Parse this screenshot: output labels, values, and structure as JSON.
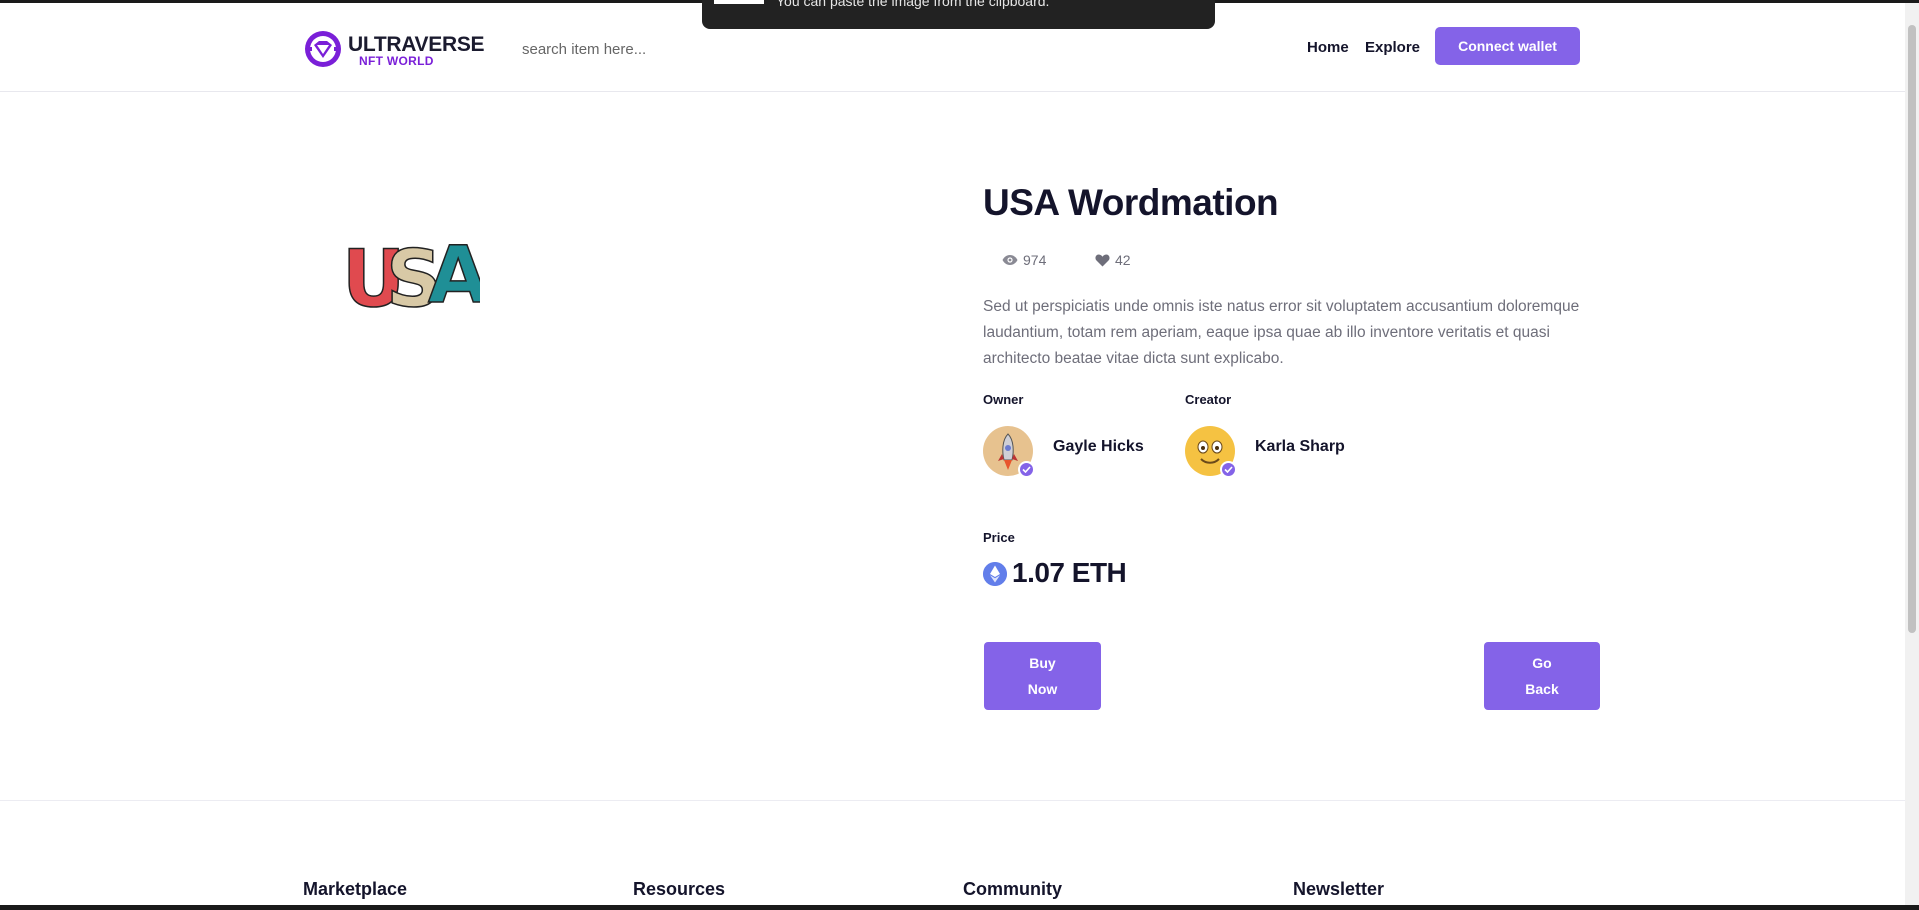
{
  "toast": {
    "text": "You can paste the image from the clipboard."
  },
  "header": {
    "logo_title": "ULTRAVERSE",
    "logo_subtitle": "NFT WORLD",
    "search_placeholder": "search item here...",
    "nav": {
      "home": "Home",
      "explore": "Explore"
    },
    "connect_wallet_label": "Connect wallet"
  },
  "item": {
    "artwork_text": "USA",
    "title": "USA Wordmation",
    "views": "974",
    "likes": "42",
    "description": "Sed ut perspiciatis unde omnis iste natus error sit voluptatem accusantium doloremque laudantium, totam rem aperiam, eaque ipsa quae ab illo inventore veritatis et quasi architecto beatae vitae dicta sunt explicabo.",
    "owner_label": "Owner",
    "owner_name": "Gayle Hicks",
    "creator_label": "Creator",
    "creator_name": "Karla Sharp",
    "price_label": "Price",
    "price": "1.07 ETH",
    "buy_label": "Buy Now",
    "back_label": "Go Back"
  },
  "footer": {
    "columns": [
      "Marketplace",
      "Resources",
      "Community",
      "Newsletter"
    ]
  },
  "colors": {
    "accent": "#8463e8",
    "text_dark": "#14142b",
    "text_muted": "#6e6e7a",
    "eth_blue": "#627eea",
    "logo_purple": "#7a1fd8"
  },
  "icons": [
    "logo-icon",
    "eye-icon",
    "heart-icon",
    "verified-icon",
    "ethereum-icon"
  ]
}
